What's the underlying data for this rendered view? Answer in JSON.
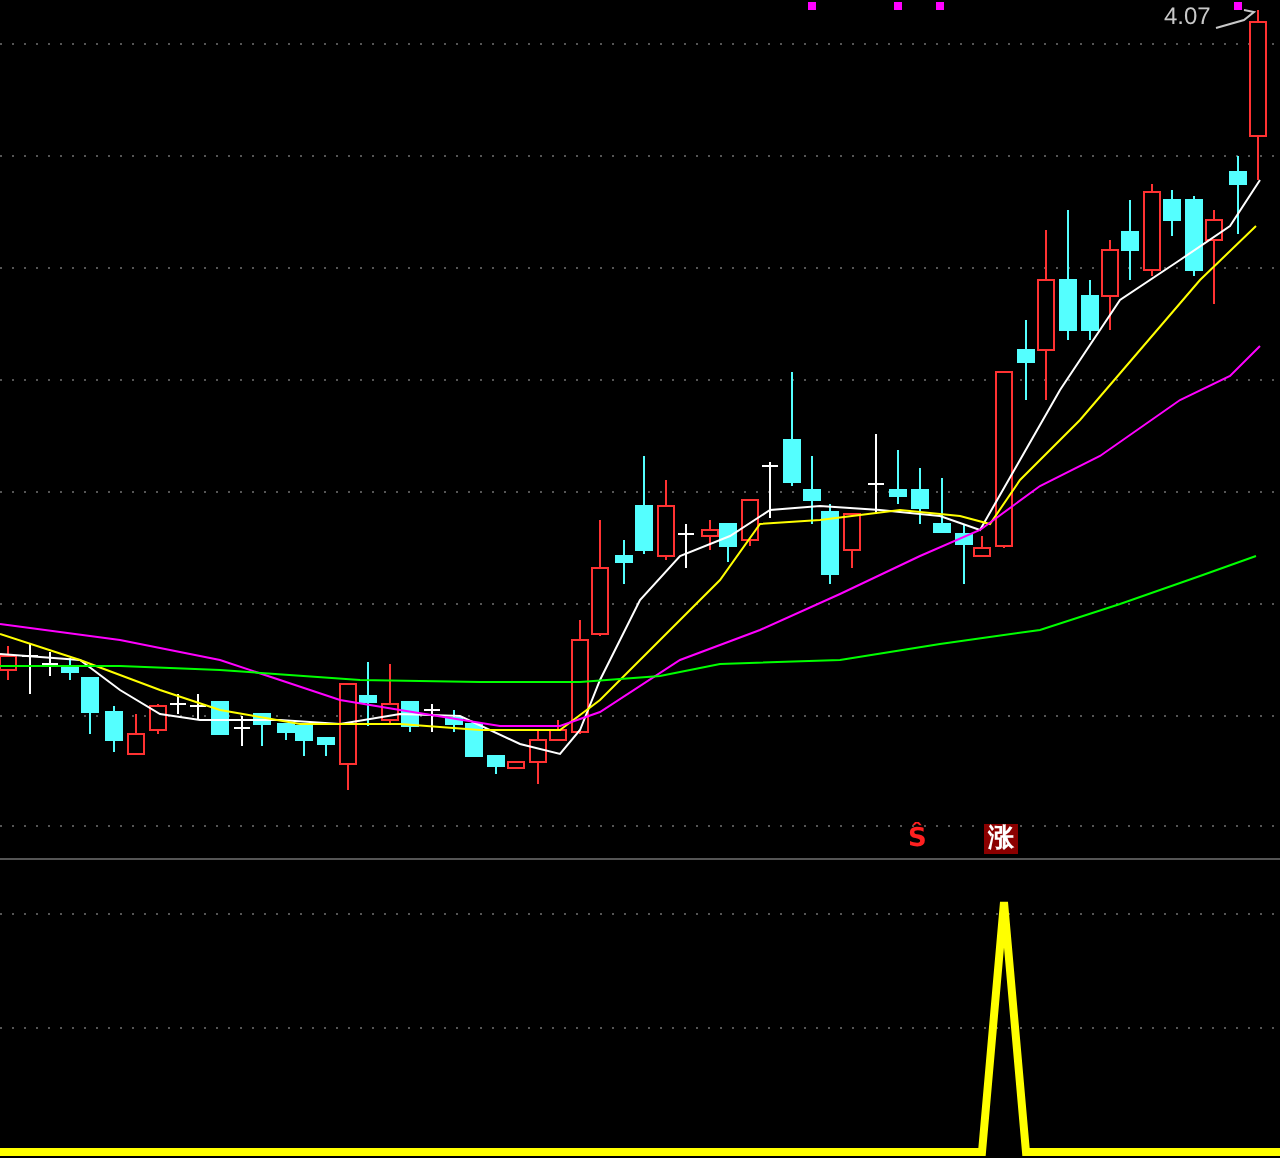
{
  "price_chart": {
    "high_label": "4.07"
  },
  "signals": [
    {
      "text": "Ŝ",
      "kind": "sell"
    },
    {
      "text": "涨",
      "kind": "rise"
    }
  ]
}
